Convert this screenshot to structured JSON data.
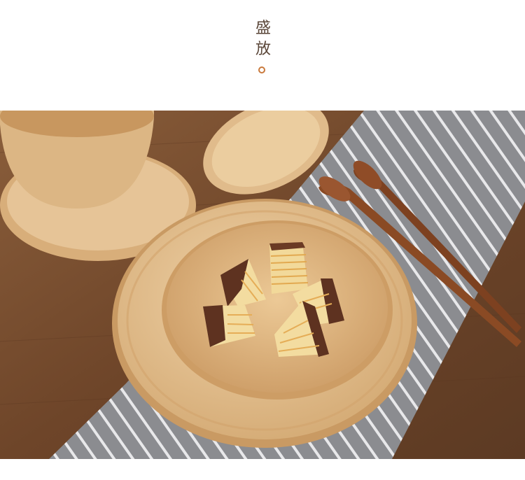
{
  "header": {
    "title_chars": [
      "盛",
      "放"
    ]
  },
  "colors": {
    "title": "#5a4638",
    "accent_dot": "#c9793c",
    "table_wood": "#7a5233",
    "plate_wood": "#e6c499",
    "napkin_gray": "#8e8e92"
  },
  "photo": {
    "subject": "product-photo"
  }
}
